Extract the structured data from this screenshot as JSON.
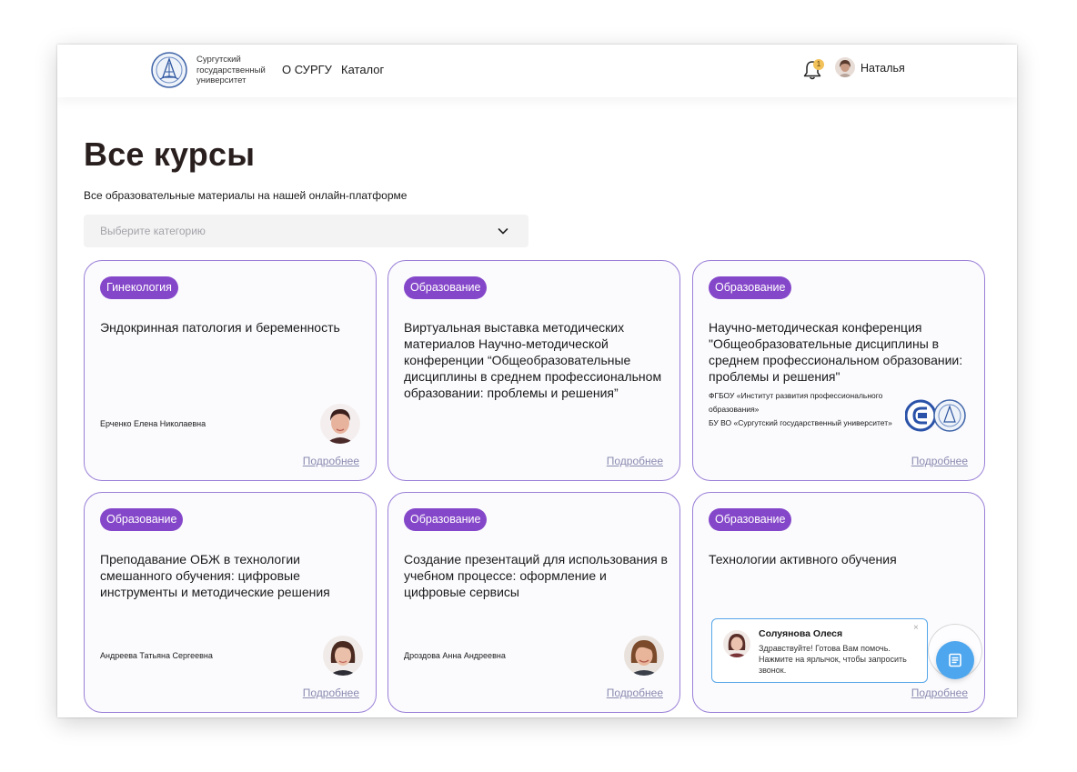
{
  "header": {
    "logo_text_line1": "Сургутский",
    "logo_text_line2": "государственный",
    "logo_text_line3": "университет",
    "nav_about": "О СУРГУ",
    "nav_catalog": "Каталог",
    "notification_count": "1",
    "user_name": "Наталья"
  },
  "page": {
    "title": "Все курсы",
    "subtitle": "Все образовательные материалы на нашей онлайн-платформе",
    "category_placeholder": "Выберите категорию"
  },
  "cards": [
    {
      "badge": "Гинекология",
      "title": "Эндокринная патология и беременность",
      "author": "Ерченко Елена Николаевна",
      "more": "Подробнее"
    },
    {
      "badge": "Образование",
      "title": "Виртуальная выставка методических материалов Научно-методической конференции “Общеобразовательные дисциплины в среднем профессиональном образовании: проблемы и решения”",
      "more": "Подробнее"
    },
    {
      "badge": "Образование",
      "title": "Научно-методическая конференция \"Общеобразовательные дисциплины в среднем профессиональном образовании: проблемы и решения\"",
      "org_line1": "ФГБОУ «Институт развития профессионального образования»",
      "org_line2": "БУ ВО «Сургутский государственный университет»",
      "more": "Подробнее"
    },
    {
      "badge": "Образование",
      "title": "Преподавание ОБЖ в технологии смешанного обучения: цифровые инструменты и методические решения",
      "author": "Андреева Татьяна Сергеевна",
      "more": "Подробнее"
    },
    {
      "badge": "Образование",
      "title": "Создание презентаций для использования в учебном процессе: оформление и цифровые сервисы",
      "author": "Дроздова Анна Андреевна",
      "more": "Подробнее"
    },
    {
      "badge": "Образование",
      "title": "Технологии активного обучения",
      "more": "Подробнее"
    }
  ],
  "chat": {
    "name": "Солуянова Олеся",
    "message": "Здравствуйте! Готова Вам помочь. Нажмите на ярлычок, чтобы запросить звонок.",
    "close": "×"
  },
  "colors": {
    "badge": "#8547c9",
    "card_border": "#9a7fd6",
    "chat_accent": "#4ea6ee",
    "title": "#2a1f1f"
  },
  "icons": {
    "logo": "university-logo-icon",
    "bell": "bell-icon",
    "chevron": "chevron-down-icon",
    "chat": "chat-icon",
    "close": "close-icon"
  }
}
